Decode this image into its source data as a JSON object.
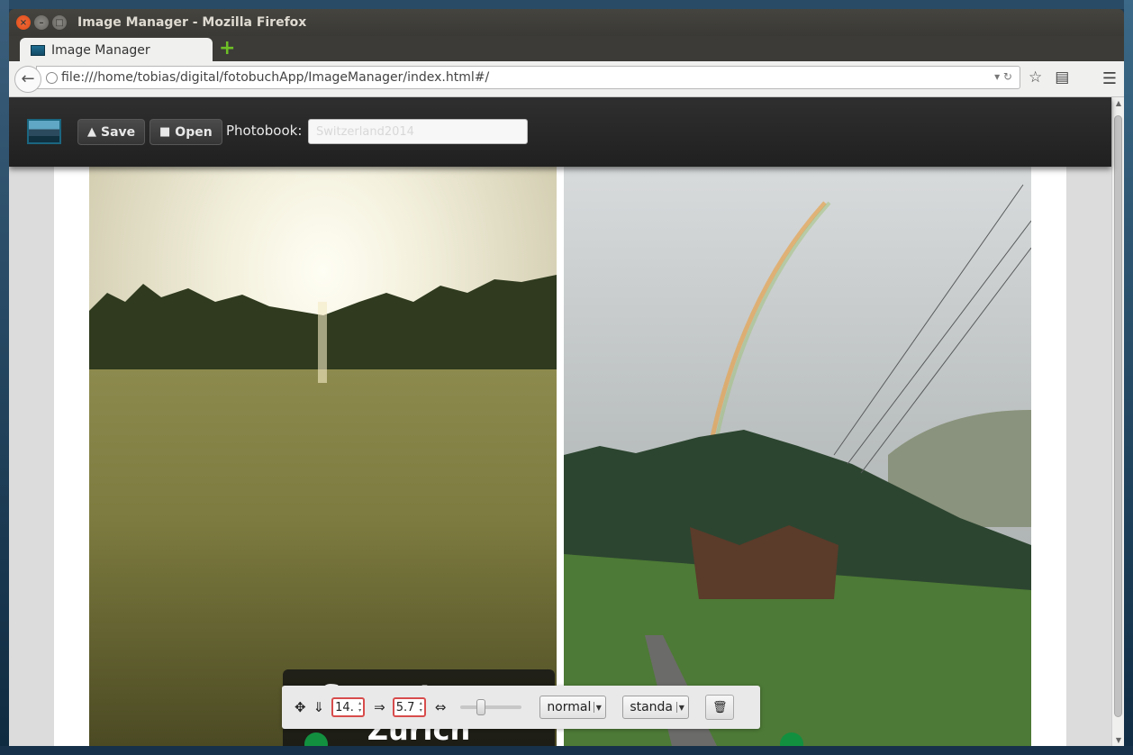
{
  "window": {
    "title": "Image Manager - Mozilla Firefox",
    "buttons": {
      "close": "×",
      "minimize": "–",
      "maximize": "□"
    }
  },
  "tabs": [
    {
      "label": "Image Manager",
      "active": true
    }
  ],
  "new_tab_label": "+",
  "navbar": {
    "url": "file:///home/tobias/digital/fotobuchApp/ImageManager/index.html#/"
  },
  "app": {
    "save_label": "Save",
    "open_label": "Open",
    "photobook_label": "Photobook:",
    "photobook_value": "Switzerland2014"
  },
  "photos": [
    {
      "subject": "sunset over meadow"
    },
    {
      "subject": "rainbow over alpine village"
    }
  ],
  "caption": {
    "text_line1": "Sunset near",
    "text_line2": "Zurich"
  },
  "editor": {
    "top_value": "14.",
    "left_value": "5.7",
    "style_select": "normal",
    "font_select": "standa"
  },
  "colors": {
    "toolbar_bg": "#262626",
    "accent_green": "#129040",
    "invalid_border": "#d84c4c"
  },
  "icons": [
    "move-icon",
    "down-arrow-icon",
    "right-arrow-icon",
    "width-icon",
    "trash-icon",
    "bookmark-star-icon",
    "reading-list-icon",
    "menu-icon"
  ]
}
